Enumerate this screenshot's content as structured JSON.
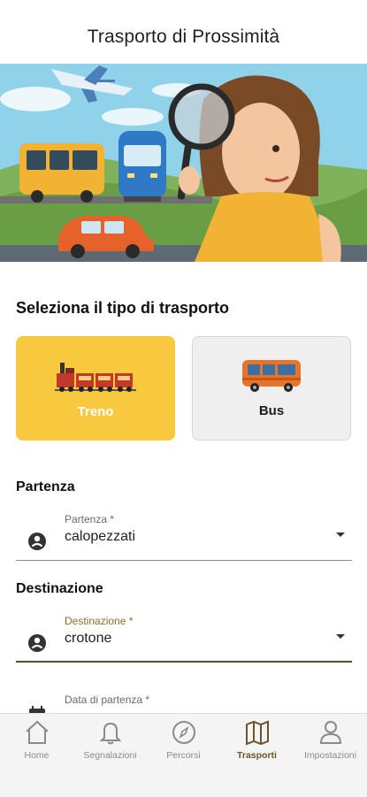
{
  "header": {
    "title": "Trasporto di Prossimità"
  },
  "hero": {
    "illustration": "transport-illustration"
  },
  "transport": {
    "section_title": "Seleziona il tipo di trasporto",
    "options": [
      {
        "label": "Treno",
        "icon": "train-icon",
        "selected": true,
        "color": "#f8c83f"
      },
      {
        "label": "Bus",
        "icon": "bus-icon",
        "selected": false,
        "color": "#efefef"
      }
    ]
  },
  "departure": {
    "section_title": "Partenza",
    "label": "Partenza *",
    "value": "calopezzati",
    "icon": "person-icon"
  },
  "destination": {
    "section_title": "Destinazione",
    "label": "Destinazione *",
    "value": "crotone",
    "icon": "person-icon"
  },
  "date": {
    "label": "Data di partenza *",
    "icon": "calendar-icon"
  },
  "nav": {
    "items": [
      {
        "label": "Home",
        "icon": "home-icon"
      },
      {
        "label": "Segnalazioni",
        "icon": "bell-icon"
      },
      {
        "label": "Percorsi",
        "icon": "compass-icon"
      },
      {
        "label": "Trasporti",
        "icon": "map-icon",
        "active": true
      },
      {
        "label": "Impostazioni",
        "icon": "person-outline-icon"
      }
    ]
  },
  "colors": {
    "accent": "#f8c83f",
    "active_nav": "#6e5426"
  }
}
